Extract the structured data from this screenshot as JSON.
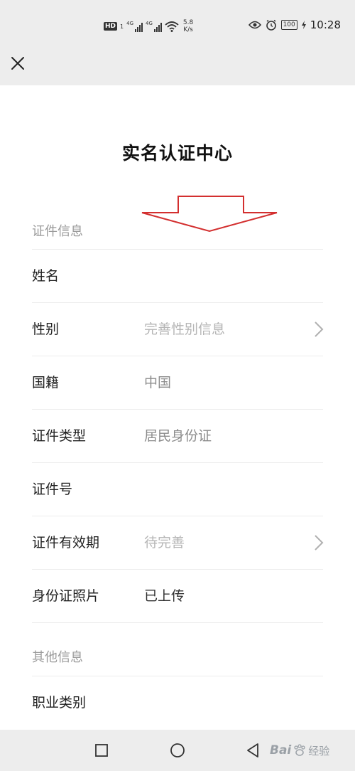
{
  "status_bar": {
    "hd_label": "HD",
    "hd_sub": "1",
    "sim1_label": "4G",
    "sim2_label": "4G",
    "speed_value": "5.8",
    "speed_unit": "K/s",
    "battery": "100",
    "time": "10:28",
    "icons": [
      "eye-icon",
      "alarm-icon",
      "battery-icon",
      "charging-icon",
      "wifi-icon",
      "signal-icon"
    ]
  },
  "top_bar": {
    "icons": [
      "close-icon"
    ]
  },
  "page": {
    "title": "实名认证中心"
  },
  "annotation": {
    "color": "#d32f2f",
    "icons": [
      "arrow-down-annotation"
    ]
  },
  "sections": {
    "id_info": {
      "header": "证件信息",
      "rows": [
        {
          "label": "姓名",
          "value": ""
        },
        {
          "label": "性别",
          "value": "完善性别信息"
        },
        {
          "label": "国籍",
          "value": "中国"
        },
        {
          "label": "证件类型",
          "value": "居民身份证"
        },
        {
          "label": "证件号",
          "value": ""
        },
        {
          "label": "证件有效期",
          "value": "待完善"
        },
        {
          "label": "身份证照片",
          "value": "已上传"
        }
      ]
    },
    "other_info": {
      "header": "其他信息",
      "rows": [
        {
          "label": "职业类别",
          "value": ""
        }
      ]
    }
  },
  "nav_bar": {
    "icons": [
      "square-icon",
      "circle-icon",
      "triangle-icon"
    ]
  },
  "watermark": {
    "text": "Bai",
    "suffix": "经验"
  },
  "colors": {
    "bar_bg": "#ededed",
    "page_bg": "#ffffff",
    "label": "#222222",
    "value": "#8c8c8c",
    "placeholder": "#b5b5b5",
    "section_header": "#9a9a9a",
    "divider": "#ececec"
  }
}
